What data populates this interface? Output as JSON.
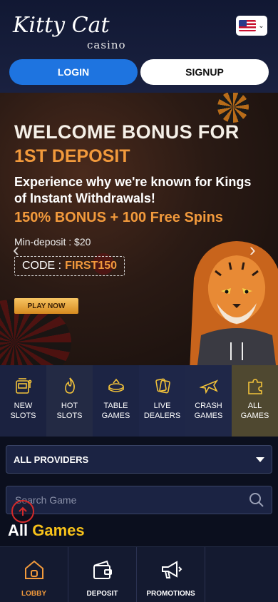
{
  "header": {
    "logo_text": "Kitty Cat",
    "logo_sub": "casino",
    "language_flag": "us-flag-icon",
    "login_label": "LOGIN",
    "signup_label": "SIGNUP"
  },
  "banner": {
    "title_line1": "WELCOME BONUS FOR",
    "title_line2": "1ST DEPOSIT",
    "subtitle": "Experience why we're known for Kings of Instant Withdrawals!",
    "bonus": "150% BONUS + 100 Free Spins",
    "min_deposit": "Min-deposit : $20",
    "code_label": "CODE :",
    "code_value": "FIRST150",
    "cta": "PLAY NOW",
    "accent_color": "#f29a3c"
  },
  "categories": [
    {
      "label1": "NEW",
      "label2": "SLOTS",
      "icon": "slot-machine-icon"
    },
    {
      "label1": "HOT",
      "label2": "SLOTS",
      "icon": "flame-icon"
    },
    {
      "label1": "TABLE",
      "label2": "GAMES",
      "icon": "table-games-icon"
    },
    {
      "label1": "LIVE",
      "label2": "DEALERS",
      "icon": "cards-icon"
    },
    {
      "label1": "CRASH",
      "label2": "GAMES",
      "icon": "airplane-icon"
    },
    {
      "label1": "ALL",
      "label2": "GAMES",
      "icon": "puzzle-icon"
    }
  ],
  "filters": {
    "provider_selected": "ALL PROVIDERS",
    "search_placeholder": "Search Game"
  },
  "section": {
    "title_white": "All",
    "title_highlight": "Games",
    "highlight_color": "#f7c21a"
  },
  "bottom_nav": [
    {
      "label": "LOBBY",
      "icon": "home-icon",
      "active": true
    },
    {
      "label": "DEPOSIT",
      "icon": "wallet-icon",
      "active": false
    },
    {
      "label": "PROMOTIONS",
      "icon": "megaphone-icon",
      "active": false
    }
  ]
}
